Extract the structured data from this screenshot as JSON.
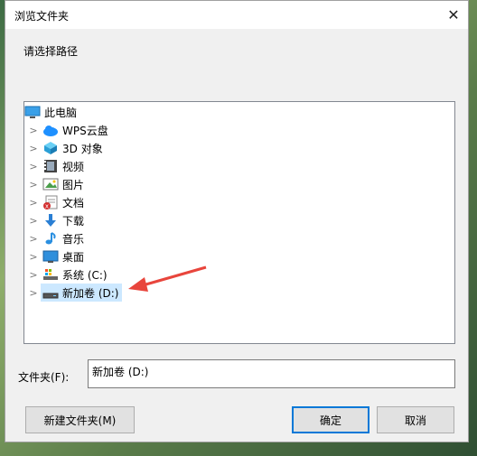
{
  "dialog": {
    "title": "浏览文件夹",
    "close_symbol": "✕",
    "prompt": "请选择路径"
  },
  "tree": {
    "items": [
      {
        "label": "此电脑",
        "icon": "computer-icon",
        "expandable": false
      },
      {
        "label": "WPS云盘",
        "icon": "cloud-icon",
        "expandable": true
      },
      {
        "label": "3D 对象",
        "icon": "3d-objects-icon",
        "expandable": true
      },
      {
        "label": "视频",
        "icon": "video-icon",
        "expandable": true
      },
      {
        "label": "图片",
        "icon": "pictures-icon",
        "expandable": true
      },
      {
        "label": "文档",
        "icon": "documents-icon",
        "expandable": true
      },
      {
        "label": "下载",
        "icon": "download-icon",
        "expandable": true
      },
      {
        "label": "音乐",
        "icon": "music-icon",
        "expandable": true
      },
      {
        "label": "桌面",
        "icon": "desktop-icon",
        "expandable": true
      },
      {
        "label": "系统 (C:)",
        "icon": "system-drive-icon",
        "expandable": true
      },
      {
        "label": "新加卷 (D:)",
        "icon": "drive-icon",
        "expandable": true,
        "selected": true
      }
    ]
  },
  "folder": {
    "label": "文件夹(F):",
    "value": "新加卷 (D:)"
  },
  "buttons": {
    "new_folder": "新建文件夹(M)",
    "ok": "确定",
    "cancel": "取消"
  },
  "colors": {
    "selection": "#cce8ff",
    "accent": "#0078d7",
    "annotation_arrow": "#e8453c"
  }
}
